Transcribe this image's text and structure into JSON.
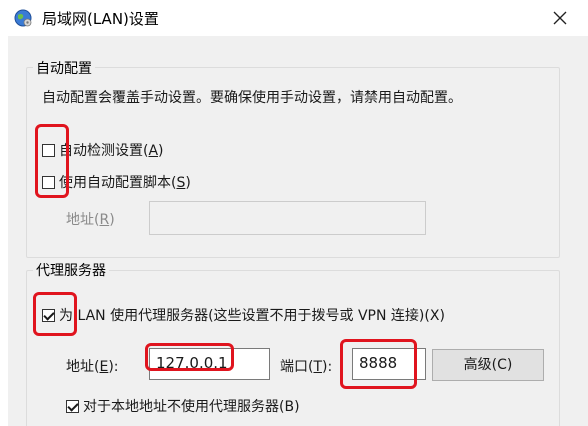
{
  "window": {
    "title": "局域网(LAN)设置",
    "icon": "globe-settings-icon",
    "close_icon": "close-icon"
  },
  "auto_config": {
    "legend": "自动配置",
    "description": "自动配置会覆盖手动设置。要确保使用手动设置，请禁用自动配置。",
    "auto_detect": {
      "label": "自动检测设置(",
      "key": "A",
      "suffix": ")",
      "checked": false
    },
    "use_script": {
      "label": "使用自动配置脚本(",
      "key": "S",
      "suffix": ")",
      "checked": false
    },
    "address": {
      "label": "地址(",
      "key": "R",
      "suffix": ")",
      "value": "",
      "disabled": true
    }
  },
  "proxy": {
    "legend": "代理服务器",
    "use_proxy": {
      "label": "为 LAN 使用代理服务器(这些设置不用于拨号或 VPN 连接)(X)",
      "checked": true
    },
    "address": {
      "label": "地址(",
      "key": "E",
      "suffix": "):",
      "value": "127.0.0.1"
    },
    "port": {
      "label": "端口(",
      "key": "T",
      "suffix": "):",
      "value": "8888"
    },
    "advanced_button": "高级(C)",
    "bypass_local": {
      "label": "对于本地地址不使用代理服务器(B)",
      "checked": true
    }
  },
  "colors": {
    "highlight_annotation": "#e0141e",
    "dialog_bg": "#f0f0f0"
  }
}
